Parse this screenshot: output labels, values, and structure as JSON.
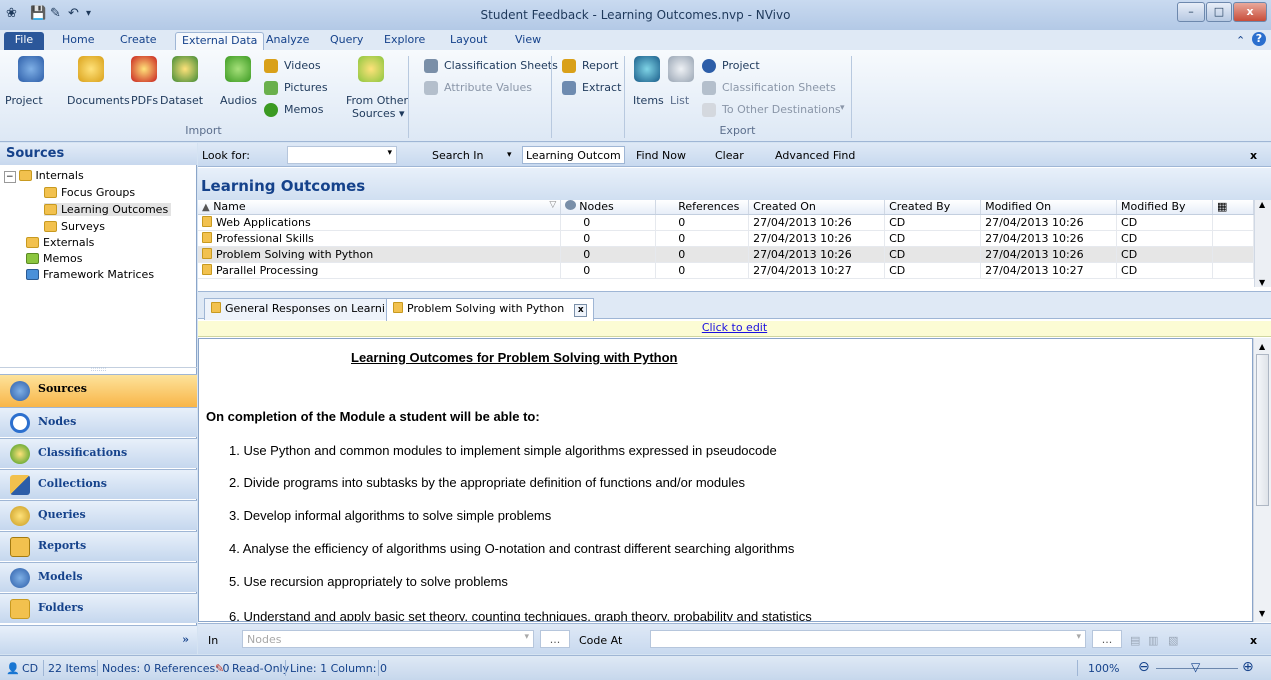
{
  "window": {
    "title": "Student Feedback - Learning Outcomes.nvp - NVivo"
  },
  "menu": {
    "tabs": [
      "File",
      "Home",
      "Create",
      "External Data",
      "Analyze",
      "Query",
      "Explore",
      "Layout",
      "View"
    ],
    "active": "External Data"
  },
  "ribbon": {
    "import_group": "Import",
    "export_group": "Export",
    "project": "Project",
    "documents": "Documents",
    "pdfs": "PDFs",
    "dataset": "Dataset",
    "audios": "Audios",
    "videos": "Videos",
    "pictures": "Pictures",
    "memos": "Memos",
    "from_other_1": "From Other",
    "from_other_2": "Sources ▾",
    "classification_sheets": "Classification Sheets",
    "attribute_values": "Attribute Values",
    "report": "Report",
    "extract": "Extract",
    "items": "Items",
    "list": "List",
    "exp_project": "Project",
    "exp_classification_sheets": "Classification Sheets",
    "to_other_destinations": "To Other Destinations"
  },
  "sources": {
    "header": "Sources",
    "tree": [
      "Internals",
      "Focus Groups",
      "Learning Outcomes",
      "Surveys",
      "Externals",
      "Memos",
      "Framework Matrices"
    ]
  },
  "nav": [
    "Sources",
    "Nodes",
    "Classifications",
    "Collections",
    "Queries",
    "Reports",
    "Models",
    "Folders"
  ],
  "findbar": {
    "look_for": "Look for:",
    "search_in": "Search In",
    "search_scope": "Learning Outcom",
    "find_now": "Find Now",
    "clear": "Clear",
    "advanced_find": "Advanced Find",
    "close": "x"
  },
  "list": {
    "title": "Learning Outcomes",
    "columns": [
      "Name",
      "Nodes",
      "References",
      "Created On",
      "Created By",
      "Modified On",
      "Modified By"
    ],
    "rows": [
      [
        "Web Applications",
        "0",
        "0",
        "27/04/2013 10:26",
        "CD",
        "27/04/2013 10:26",
        "CD"
      ],
      [
        "Professional Skills",
        "0",
        "0",
        "27/04/2013 10:26",
        "CD",
        "27/04/2013 10:26",
        "CD"
      ],
      [
        "Problem Solving with Python",
        "0",
        "0",
        "27/04/2013 10:26",
        "CD",
        "27/04/2013 10:26",
        "CD"
      ],
      [
        "Parallel Processing",
        "0",
        "0",
        "27/04/2013 10:27",
        "CD",
        "27/04/2013 10:27",
        "CD"
      ]
    ]
  },
  "doc_tabs": [
    "General Responses on Learni",
    "Problem Solving with Python"
  ],
  "click_to_edit": "Click to edit",
  "document": {
    "heading": "Learning Outcomes for Problem Solving with Python",
    "intro": "On completion of the Module a student will be able to:",
    "items": [
      "1.   Use Python and common modules to implement simple algorithms expressed in pseudocode",
      "2.   Divide programs into subtasks by the appropriate definition of functions and/or modules",
      "3.   Develop informal algorithms to solve simple problems",
      "4.   Analyse the efficiency of algorithms using O-notation and contrast different searching algorithms",
      "5.   Use recursion appropriately to solve problems",
      "6.   Understand and apply basic set theory, counting techniques, graph theory, probability and statistics"
    ]
  },
  "codebar": {
    "in": "In",
    "nodes_placeholder": "Nodes",
    "code_at": "Code At",
    "ellipsis": "...",
    "close": "x"
  },
  "status": {
    "user": "CD",
    "items": "22 Items",
    "nodes_refs": "Nodes: 0  References: 0",
    "readonly": "Read-Only",
    "position": "Line: 1  Column: 0",
    "zoom": "100%"
  }
}
